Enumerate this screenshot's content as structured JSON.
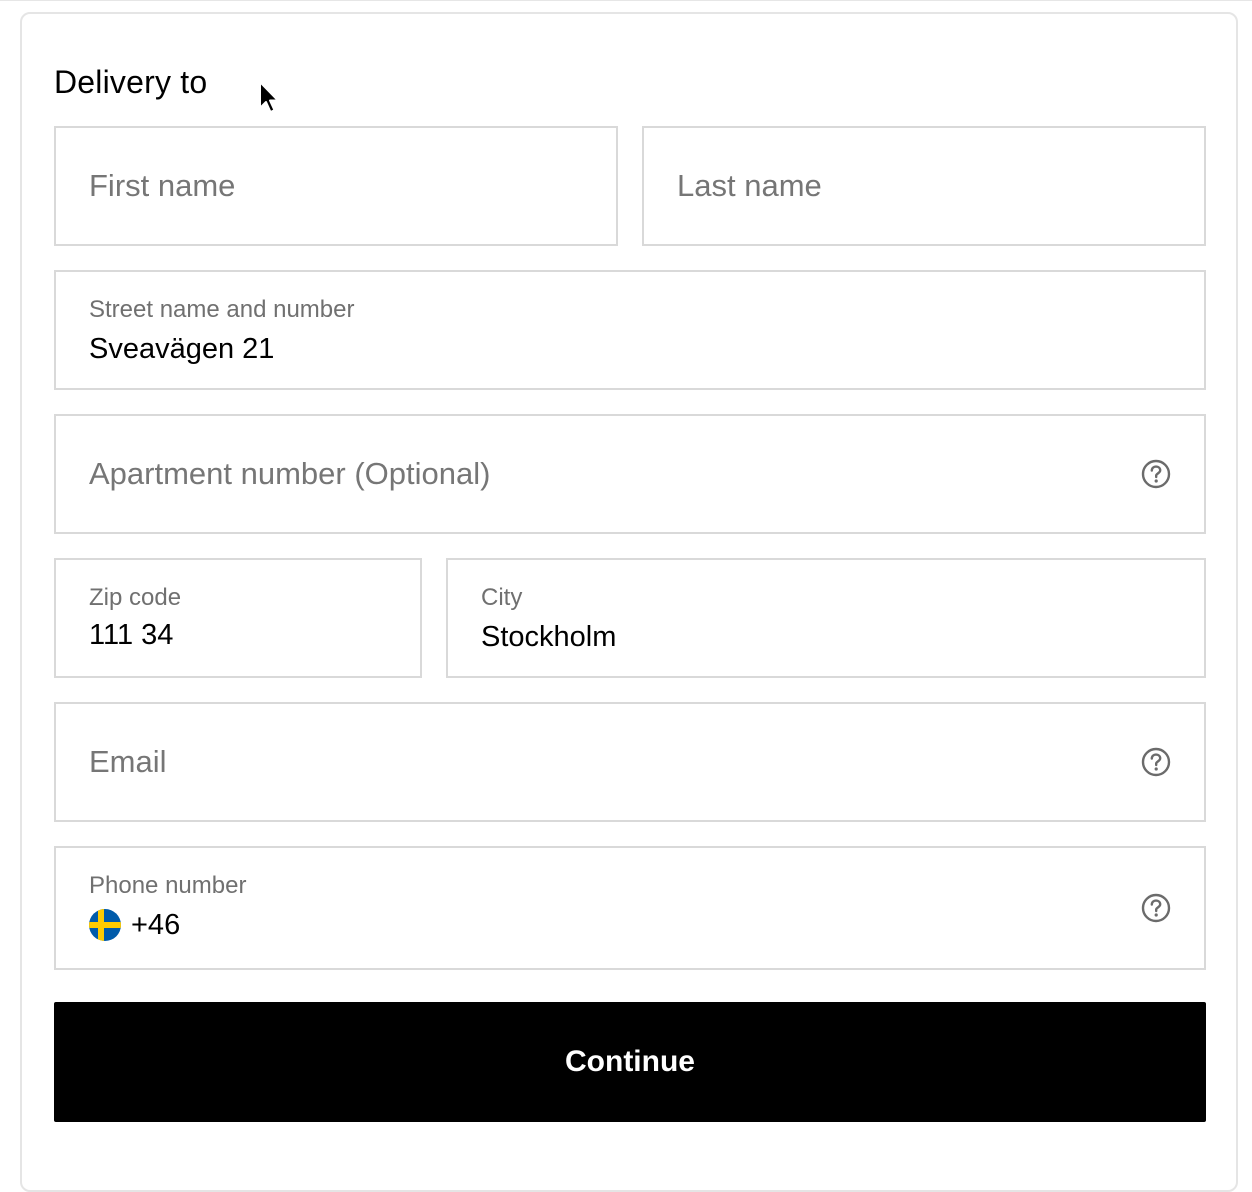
{
  "form": {
    "title": "Delivery to",
    "first_name": {
      "placeholder": "First name"
    },
    "last_name": {
      "placeholder": "Last name"
    },
    "street": {
      "label": "Street name and number",
      "value": "Sveavägen 21"
    },
    "apartment": {
      "placeholder": "Apartment number (Optional)",
      "icon": "help-circle-icon"
    },
    "zip": {
      "label": "Zip code",
      "value": "111 34"
    },
    "city": {
      "label": "City",
      "value": "Stockholm"
    },
    "email": {
      "placeholder": "Email",
      "icon": "help-circle-icon"
    },
    "phone": {
      "label": "Phone number",
      "country_code": "+46",
      "flag": "sweden-flag-icon",
      "icon": "help-circle-icon"
    },
    "continue_label": "Continue"
  },
  "colors": {
    "button_bg": "#000000",
    "button_text": "#ffffff",
    "field_border": "#d9d9d9",
    "placeholder": "#767676",
    "label": "#707070",
    "flag_blue": "#005BAA",
    "flag_yellow": "#FECB00"
  }
}
